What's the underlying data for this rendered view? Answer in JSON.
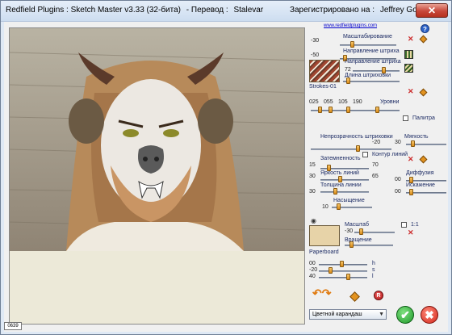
{
  "window": {
    "title_parts": [
      "Redfield Plugins : Sketch Master v3.33 (32-бита)",
      "- Перевод :",
      "Stalevar",
      "Зарегистрировано на :",
      "Jeffrey Godsy"
    ],
    "close_glyph": "✕"
  },
  "status": {
    "zoom_readout": "0639"
  },
  "panel": {
    "link": "www.redfieldplugins.com",
    "help_glyph": "?",
    "scale": {
      "label": "Масштабирование",
      "value": "-30"
    },
    "stroke_dir1": {
      "label": "Направление штриха",
      "value": "-50"
    },
    "stroke_dir2": {
      "label": "Направление штриха",
      "value": "72"
    },
    "stroke_len": {
      "label": "Длина штриховки"
    },
    "stroke_preset": "Strokes-01",
    "levels": {
      "label": "Уровни",
      "values": [
        "025",
        "055",
        "105",
        "190"
      ]
    },
    "palette": {
      "label": "Палитра"
    },
    "opacity": {
      "label": "Непрозрачность штриховки",
      "value": "-20"
    },
    "softness": {
      "label": "Мягкость",
      "value": "30"
    },
    "contour": {
      "label": "Контур линий"
    },
    "darkness": {
      "label": "Затемненность",
      "value_left": "15",
      "value_right": "70"
    },
    "line_bright": {
      "label": "Яркость линий",
      "value": "30",
      "value2": "65"
    },
    "diffusion": {
      "label": "Диффузия",
      "value": "00"
    },
    "line_thick": {
      "label": "Толщина линии",
      "value": "30"
    },
    "distortion": {
      "label": "Искажение",
      "value": "00"
    },
    "saturation": {
      "label": "Насыщение",
      "value": "10"
    },
    "paper_scale": {
      "label": "Масштаб",
      "value": "-30",
      "ratio": "1:1"
    },
    "rotation": {
      "label": "Вращение"
    },
    "paper_name": "Paperboard",
    "hsl": {
      "h": "00",
      "s": "-20",
      "l": "40",
      "h_label": "h",
      "s_label": "s",
      "l_label": "l"
    },
    "reset_glyph": "R",
    "preset_select": "Цветной карандаш",
    "ok_glyph": "✔",
    "cancel_glyph": "✖"
  },
  "colors": {
    "accent_orange": "#e3931f",
    "close_red": "#c7473a",
    "ok_green": "#1f9a2a"
  }
}
